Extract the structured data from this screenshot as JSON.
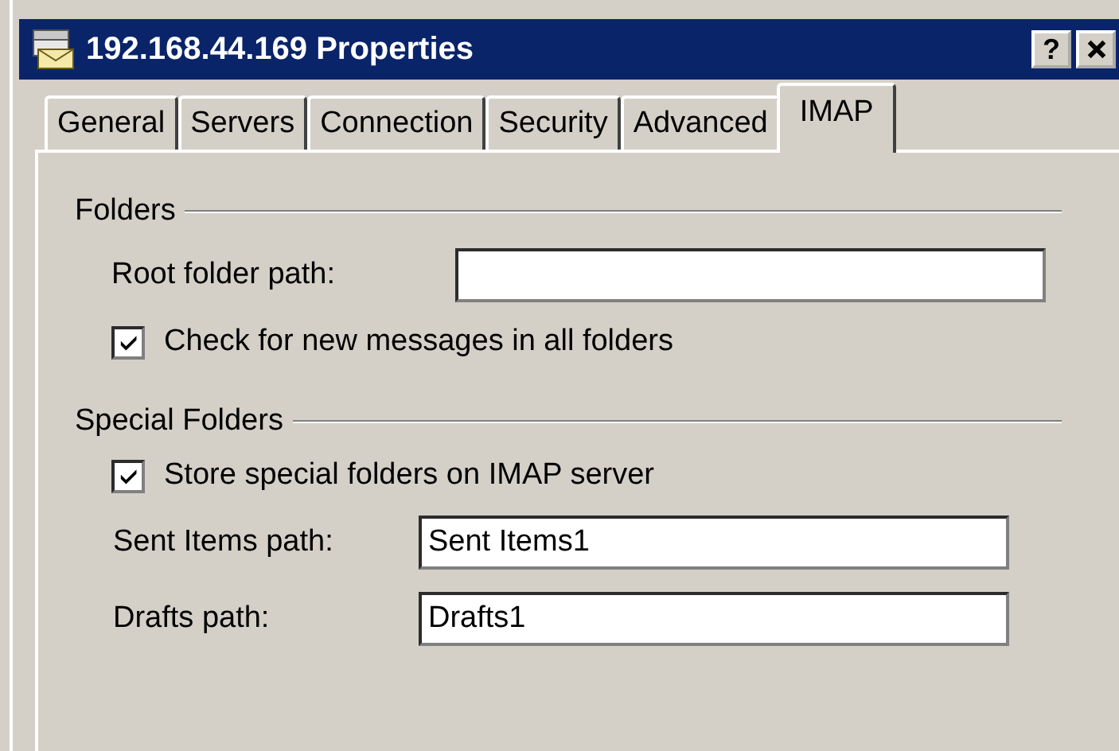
{
  "window": {
    "title": "192.168.44.169 Properties",
    "help_button": "?"
  },
  "tabs": [
    {
      "label": "General",
      "selected": false
    },
    {
      "label": "Servers",
      "selected": false
    },
    {
      "label": "Connection",
      "selected": false
    },
    {
      "label": "Security",
      "selected": false
    },
    {
      "label": "Advanced",
      "selected": false
    },
    {
      "label": "IMAP",
      "selected": true
    }
  ],
  "groups": [
    {
      "title": "Folders",
      "items": [
        {
          "kind": "field",
          "label": "Root folder path:"
        },
        {
          "kind": "checkbox",
          "label": "Check for new messages in all folders",
          "checked": true
        }
      ]
    },
    {
      "title": "Special Folders",
      "items": [
        {
          "kind": "checkbox",
          "label": "Store special folders on IMAP server",
          "checked": true,
          "children": [
            {
              "kind": "field",
              "label": "Sent Items path:",
              "value": "Sent Items1"
            },
            {
              "kind": "field",
              "label": "Drafts path:",
              "value": "Drafts1"
            }
          ]
        }
      ]
    }
  ]
}
